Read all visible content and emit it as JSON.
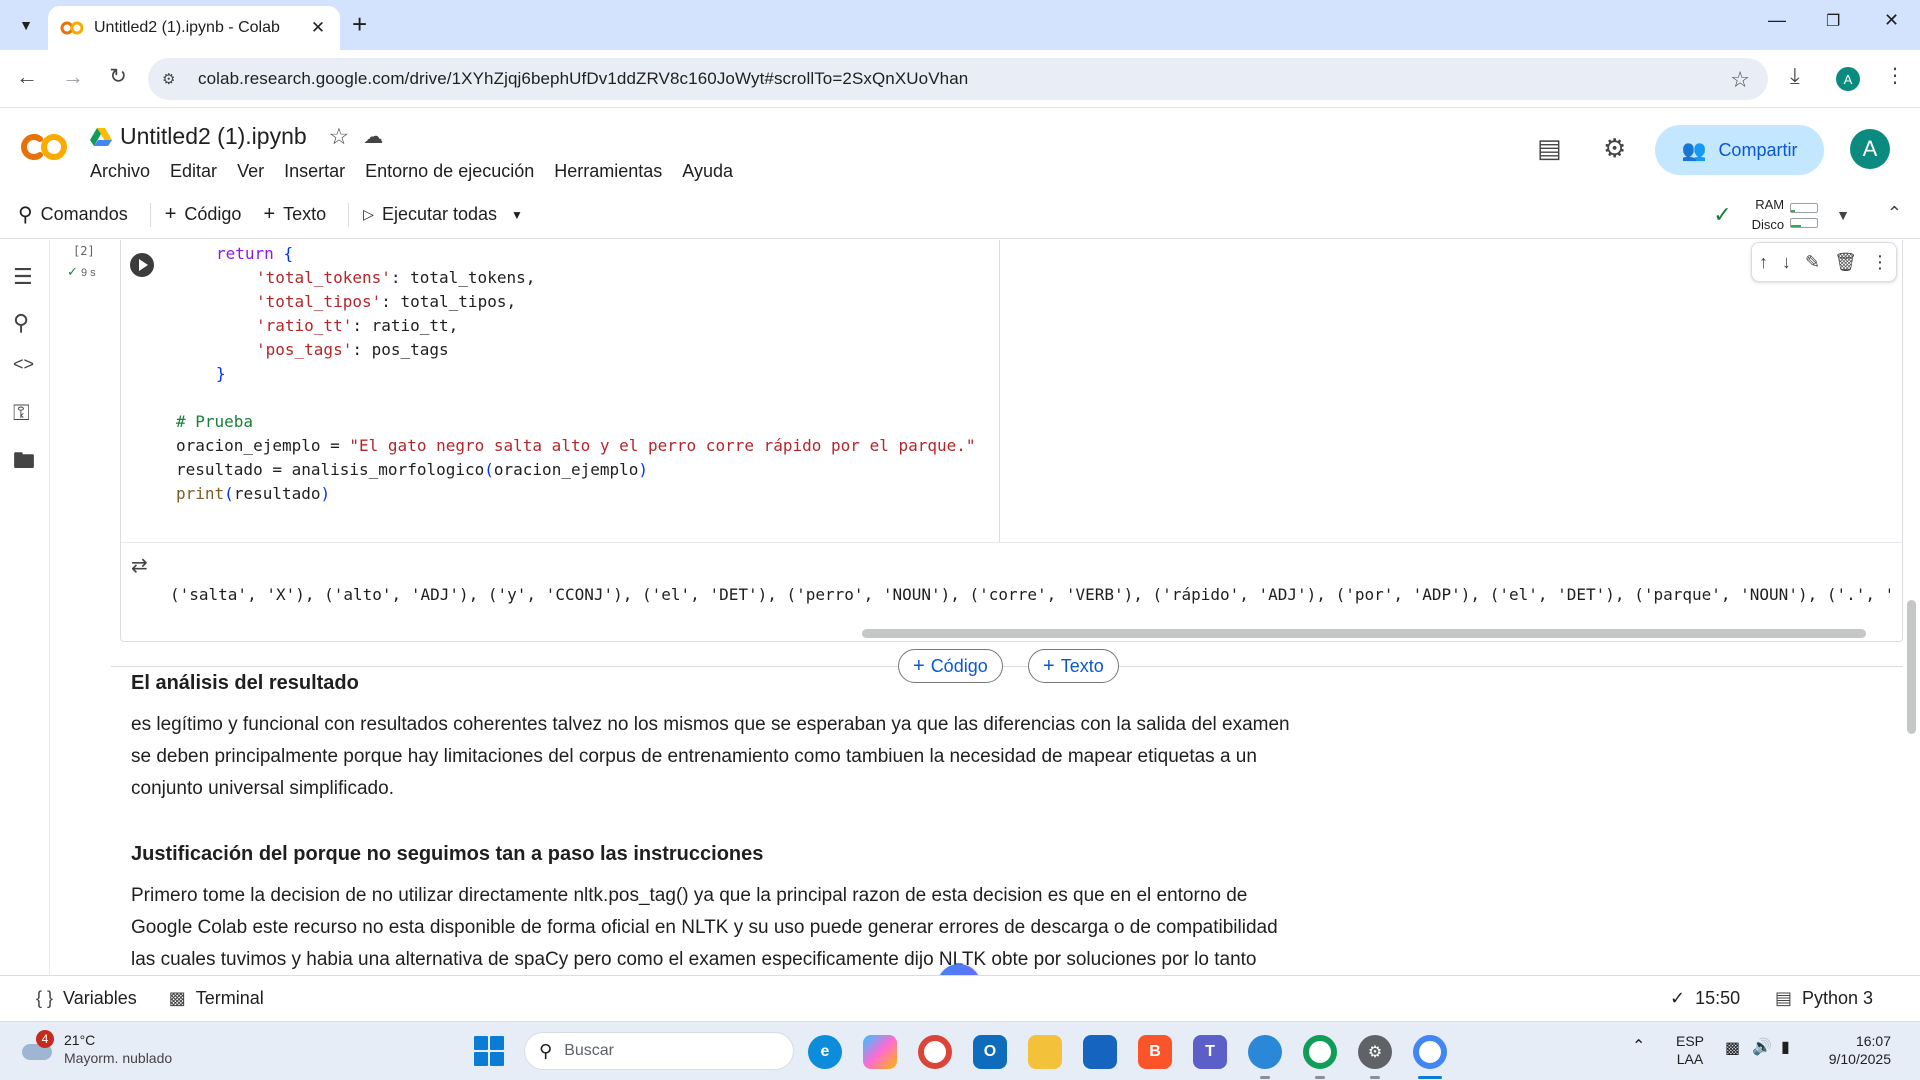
{
  "browser": {
    "tab_title": "Untitled2 (1).ipynb - Colab",
    "url": "colab.research.google.com/drive/1XYhZjqj6bephUfDv1ddZRV8c160JoWyt#scrollTo=2SxQnXUoVhan",
    "profile_initial": "A"
  },
  "header": {
    "notebook_title": "Untitled2 (1).ipynb",
    "menu": [
      "Archivo",
      "Editar",
      "Ver",
      "Insertar",
      "Entorno de ejecución",
      "Herramientas",
      "Ayuda"
    ],
    "share_label": "Compartir",
    "avatar_initial": "A"
  },
  "commandbar": {
    "commands_label": "Comandos",
    "add_code_label": "Código",
    "add_text_label": "Texto",
    "run_all_label": "Ejecutar todas",
    "ram_label": "RAM",
    "disk_label": "Disco"
  },
  "cell": {
    "exec_count": "[2]",
    "exec_time": "9 s",
    "output_line": "('salta', 'X'), ('alto', 'ADJ'), ('y', 'CCONJ'), ('el', 'DET'), ('perro', 'NOUN'), ('corre', 'VERB'), ('rápido', 'ADJ'), ('por', 'ADP'), ('el', 'DET'), ('parque', 'NOUN'), ('.', '"
  },
  "insert": {
    "code_label": "Código",
    "text_label": "Texto"
  },
  "markdown": {
    "heading1": "El análisis del resultado",
    "para1_line1": "es legítimo y funcional con resultados coherentes talvez no los mismos que se esperaban ya que las diferencias con la salida del examen",
    "para1_line2": "se deben principalmente porque hay limitaciones del corpus de entrenamiento como tambiuen la necesidad de mapear etiquetas a un",
    "para1_line3": "conjunto universal simplificado.",
    "heading2": "Justificación del porque no seguimos tan a paso las instrucciones",
    "para2_line1": "Primero tome la decision de no utilizar directamente nltk.pos_tag() ya que la principal razon de esta decision es que en el entorno de",
    "para2_line2": "Google Colab este recurso no esta disponible de forma oficial en NLTK y su uso puede generar errores de descarga o de compatibilidad",
    "para2_line3": "las cuales tuvimos y habia una alternativa de spaCy pero como el examen especificamente dijo NLTK obte por soluciones por lo tanto"
  },
  "statusbar": {
    "variables_label": "Variables",
    "terminal_label": "Terminal",
    "time": "15:50",
    "runtime": "Python 3"
  },
  "taskbar": {
    "weather_badge": "4",
    "temperature": "21°C",
    "weather_desc": "Mayorm. nublado",
    "search_placeholder": "Buscar",
    "lang_line1": "ESP",
    "lang_line2": "LAA",
    "clock_time": "16:07",
    "clock_date": "9/10/2025"
  },
  "colors": {
    "accent": "#0b57d0",
    "share_bg": "#c2e7ff",
    "tabstrip": "#d3e3fd",
    "colab_orange": "#f9ab00"
  }
}
